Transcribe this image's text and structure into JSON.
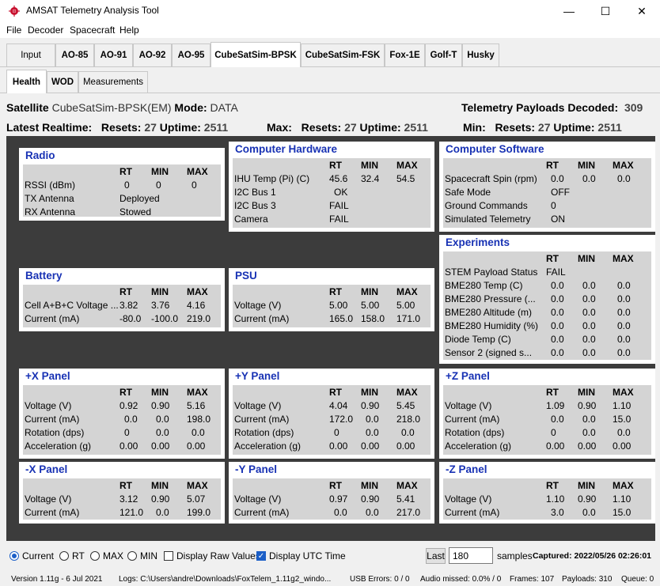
{
  "window": {
    "title": "AMSAT Telemetry Analysis Tool",
    "minimize": "—",
    "maximize": "☐",
    "close": "✕"
  },
  "menu": [
    "File",
    "Decoder",
    "Spacecraft",
    "Help"
  ],
  "tabs": [
    "Input",
    "AO-85",
    "AO-91",
    "AO-92",
    "AO-95",
    "CubeSatSim-BPSK",
    "CubeSatSim-FSK",
    "Fox-1E",
    "Golf-T",
    "Husky"
  ],
  "subtabs": [
    "Health",
    "WOD",
    "Measurements"
  ],
  "header": {
    "satellite_label": "Satellite",
    "satellite_name": "CubeSatSim-BPSK(EM)",
    "mode_label": "Mode:",
    "mode_value": "DATA",
    "payloads_label": "Telemetry Payloads Decoded:",
    "payloads_value": "309",
    "latest_label": "Latest Realtime:",
    "resets_label": "Resets:",
    "uptime_label": "Uptime:",
    "latest_resets": "27",
    "latest_uptime": "2511",
    "max_label": "Max:",
    "max_resets": "27",
    "max_uptime": "2511",
    "min_label": "Min:",
    "min_resets": "27",
    "min_uptime": "2511"
  },
  "col_headers": {
    "rt": "RT",
    "min": "MIN",
    "max": "MAX"
  },
  "panels": {
    "radio": {
      "title": "Radio",
      "rows": [
        [
          "RSSI (dBm)",
          "0",
          "0",
          "0"
        ],
        [
          "TX Antenna",
          "Deployed",
          "",
          ""
        ],
        [
          "RX Antenna",
          "Stowed",
          "",
          ""
        ]
      ]
    },
    "computer_hardware": {
      "title": "Computer Hardware",
      "rows": [
        [
          "IHU Temp (Pi) (C)",
          "45.6",
          "32.4",
          "54.5"
        ],
        [
          "I2C Bus 1",
          "OK",
          "",
          ""
        ],
        [
          "I2C Bus 3",
          "FAIL",
          "",
          ""
        ],
        [
          "Camera",
          "FAIL",
          "",
          ""
        ]
      ]
    },
    "computer_software": {
      "title": "Computer Software",
      "rows": [
        [
          "Spacecraft Spin (rpm)",
          "0.0",
          "0.0",
          "0.0"
        ],
        [
          "Safe Mode",
          "OFF",
          "",
          ""
        ],
        [
          "Ground Commands",
          "0",
          "",
          ""
        ],
        [
          "Simulated Telemetry",
          "ON",
          "",
          ""
        ]
      ]
    },
    "experiments": {
      "title": "Experiments",
      "rows": [
        [
          "STEM Payload Status",
          "FAIL",
          "",
          ""
        ],
        [
          "BME280 Temp (C)",
          "0.0",
          "0.0",
          "0.0"
        ],
        [
          "BME280 Pressure (...",
          "0.0",
          "0.0",
          "0.0"
        ],
        [
          "BME280 Altitude (m)",
          "0.0",
          "0.0",
          "0.0"
        ],
        [
          "BME280 Humidity (%)",
          "0.0",
          "0.0",
          "0.0"
        ],
        [
          "Diode Temp (C)",
          "0.0",
          "0.0",
          "0.0"
        ],
        [
          "Sensor 2 (signed s...",
          "0.0",
          "0.0",
          "0.0"
        ]
      ]
    },
    "battery": {
      "title": "Battery",
      "rows": [
        [
          "Cell A+B+C Voltage ...",
          "3.82",
          "3.76",
          "4.16"
        ],
        [
          "Current (mA)",
          "-80.0",
          "-100.0",
          "219.0"
        ]
      ]
    },
    "psu": {
      "title": "PSU",
      "rows": [
        [
          "Voltage (V)",
          "5.00",
          "5.00",
          "5.00"
        ],
        [
          "Current (mA)",
          "165.0",
          "158.0",
          "171.0"
        ]
      ]
    },
    "plus_x": {
      "title": "+X Panel",
      "rows": [
        [
          "Voltage (V)",
          "0.92",
          "0.90",
          "5.16"
        ],
        [
          "Current (mA)",
          "0.0",
          "0.0",
          "198.0"
        ],
        [
          "Rotation (dps)",
          "0",
          "0.0",
          "0.0"
        ],
        [
          "Acceleration (g)",
          "0.00",
          "0.00",
          "0.00"
        ]
      ]
    },
    "plus_y": {
      "title": "+Y Panel",
      "rows": [
        [
          "Voltage (V)",
          "4.04",
          "0.90",
          "5.45"
        ],
        [
          "Current (mA)",
          "172.0",
          "0.0",
          "218.0"
        ],
        [
          "Rotation (dps)",
          "0",
          "0.0",
          "0.0"
        ],
        [
          "Acceleration (g)",
          "0.00",
          "0.00",
          "0.00"
        ]
      ]
    },
    "plus_z": {
      "title": "+Z Panel",
      "rows": [
        [
          "Voltage (V)",
          "1.09",
          "0.90",
          "1.10"
        ],
        [
          "Current (mA)",
          "0.0",
          "0.0",
          "15.0"
        ],
        [
          "Rotation (dps)",
          "0",
          "0.0",
          "0.0"
        ],
        [
          "Acceleration (g)",
          "0.00",
          "0.00",
          "0.00"
        ]
      ]
    },
    "minus_x": {
      "title": "-X Panel",
      "rows": [
        [
          "Voltage (V)",
          "3.12",
          "0.90",
          "5.07"
        ],
        [
          "Current (mA)",
          "121.0",
          "0.0",
          "199.0"
        ]
      ]
    },
    "minus_y": {
      "title": "-Y Panel",
      "rows": [
        [
          "Voltage (V)",
          "0.97",
          "0.90",
          "5.41"
        ],
        [
          "Current (mA)",
          "0.0",
          "0.0",
          "217.0"
        ]
      ]
    },
    "minus_z": {
      "title": "-Z Panel",
      "rows": [
        [
          "Voltage (V)",
          "1.10",
          "0.90",
          "1.10"
        ],
        [
          "Current (mA)",
          "3.0",
          "0.0",
          "15.0"
        ]
      ]
    }
  },
  "controls": {
    "radio_current": "Current",
    "radio_rt": "RT",
    "radio_max": "MAX",
    "radio_min": "MIN",
    "selected": "Current",
    "display_raw": "Display Raw Values",
    "display_raw_checked": false,
    "display_utc": "Display UTC Time",
    "display_utc_checked": true,
    "last_button": "Last",
    "samples_value": "180",
    "samples_label": "samples",
    "captured": "Captured: 2022/05/26 02:26:01"
  },
  "status": {
    "version": "Version 1.11g - 6 Jul 2021",
    "logs": "Logs: C:\\Users\\andre\\Downloads\\FoxTelem_1.11g2_windo...",
    "usb_errors": "USB Errors: 0 / 0",
    "audio_missed": "Audio missed: 0.0% / 0",
    "frames": "Frames: 107",
    "payloads": "Payloads: 310",
    "queue": "Queue: 0"
  },
  "colors": {
    "panel_title": "#1832b4",
    "dark_bg": "#3c3c3c",
    "panel_body": "#d4d4d4",
    "accent": "#1c5fc7"
  },
  "icons": [
    "amsat-satellite-icon"
  ]
}
